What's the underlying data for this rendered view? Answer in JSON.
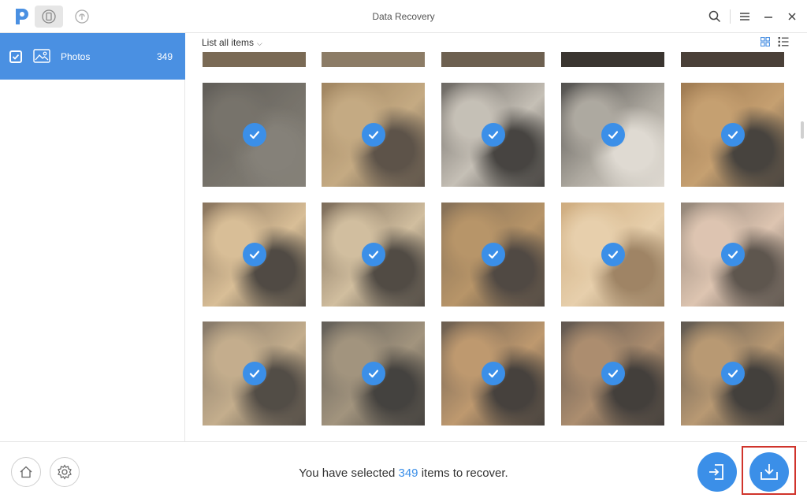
{
  "app": {
    "title": "Data Recovery",
    "accent": "#4a90e2"
  },
  "sidebar": {
    "items": [
      {
        "label": "Photos",
        "count": "349",
        "checked": true
      }
    ]
  },
  "toolbar": {
    "filter_label": "List all items"
  },
  "grid": {
    "selected_count": 15,
    "thumbnails": [
      {
        "name": "photo-1",
        "checked": true
      },
      {
        "name": "photo-2",
        "checked": true
      },
      {
        "name": "photo-3",
        "checked": true
      },
      {
        "name": "photo-4",
        "checked": true
      },
      {
        "name": "photo-5",
        "checked": true
      },
      {
        "name": "photo-6",
        "checked": true
      },
      {
        "name": "photo-7",
        "checked": true
      },
      {
        "name": "photo-8",
        "checked": true
      },
      {
        "name": "photo-9",
        "checked": true
      },
      {
        "name": "photo-10",
        "checked": true
      },
      {
        "name": "photo-11",
        "checked": true
      },
      {
        "name": "photo-12",
        "checked": true
      },
      {
        "name": "photo-13",
        "checked": true
      },
      {
        "name": "photo-14",
        "checked": true
      },
      {
        "name": "photo-15",
        "checked": true
      }
    ]
  },
  "footer": {
    "status_prefix": "You have selected",
    "status_count": "349",
    "status_suffix": "items to recover."
  }
}
